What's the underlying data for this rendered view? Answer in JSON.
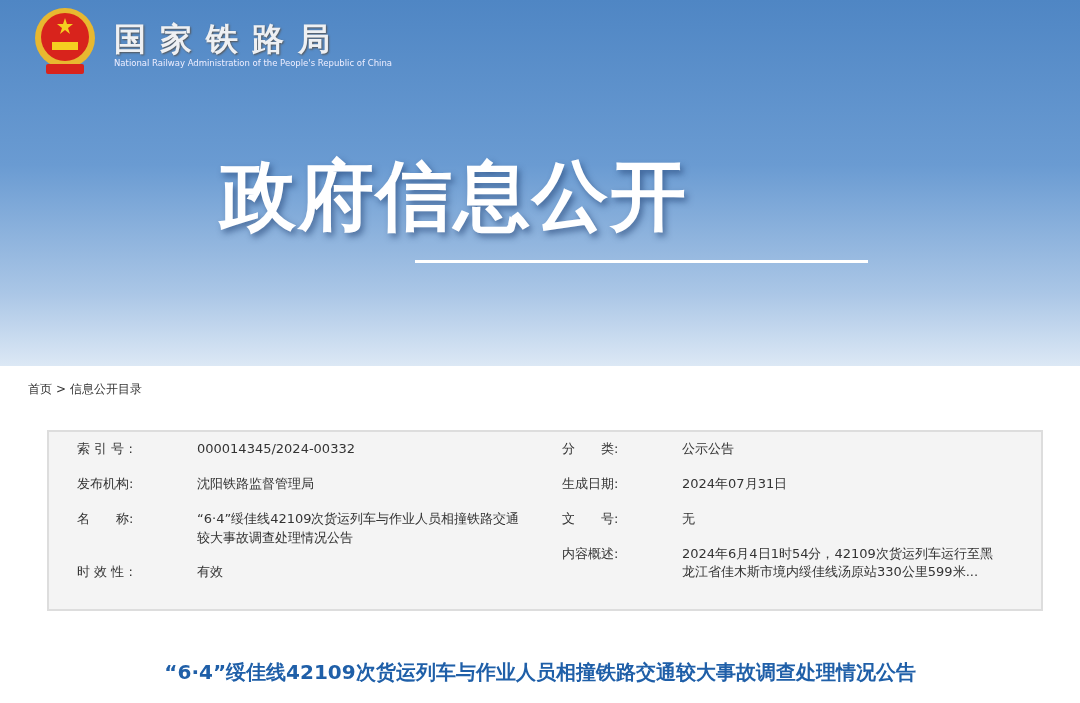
{
  "header": {
    "title": "国家铁路局",
    "subtitle": "National Railway Administration of the People's Republic of China"
  },
  "banner_title": "政府信息公开",
  "breadcrumb": {
    "separator": ">",
    "items": [
      {
        "label": "首页"
      },
      {
        "label": "信息公开目录"
      }
    ]
  },
  "info": {
    "left": [
      {
        "label": "索 引 号 :",
        "value": "000014345/2024-00332"
      },
      {
        "label": "发布机构:",
        "value": "沈阳铁路监督管理局"
      },
      {
        "label": "名　　称:",
        "value": "“6·4”绥佳线42109次货运列车与作业人员相撞铁路交通较大事故调查处理情况公告"
      },
      {
        "label": "时 效 性 :",
        "value": "有效"
      }
    ],
    "right": [
      {
        "label": "分　　类:",
        "value": "公示公告"
      },
      {
        "label": "生成日期:",
        "value": "2024年07月31日"
      },
      {
        "label": "文　　号:",
        "value": "无"
      },
      {
        "label": "内容概述:",
        "value": "2024年6月4日1时54分，42109次货运列车运行至黑龙江省佳木斯市境内绥佳线汤原站330公里599米..."
      }
    ]
  },
  "article_title": "“6·4”绥佳线42109次货运列车与作业人员相撞铁路交通较大事故调查处理情况公告"
}
